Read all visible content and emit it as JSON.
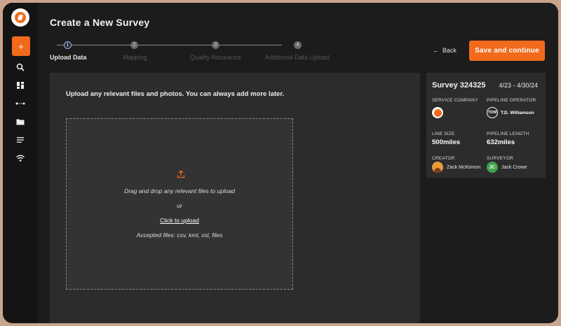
{
  "page": {
    "title": "Create a New Survey"
  },
  "stepper": {
    "steps": [
      {
        "number": "1",
        "label": "Upload Data"
      },
      {
        "number": "2",
        "label": "Mapping"
      },
      {
        "number": "3",
        "label": "Quality Assurance"
      },
      {
        "number": "4",
        "label": "Additional Data Upload"
      }
    ]
  },
  "actions": {
    "back_label": "Back",
    "save_label": "Save and continue"
  },
  "sidebar": {
    "add_label": "+",
    "icons": [
      "search-icon",
      "dashboard-icon",
      "pipeline-icon",
      "folder-icon",
      "list-icon",
      "wifi-icon"
    ]
  },
  "upload": {
    "intro": "Upload any relevant files and photos. You can always add more later.",
    "drag_text": "Drag and drop any relevant files to upload",
    "or_text": "or",
    "click_text": "Click to upload",
    "accepted_text": "Accepted files: csv, kml, xsl, files"
  },
  "survey": {
    "title": "Survey 324325",
    "dates": "4/23 - 4/30/24",
    "service_company_label": "SERVICE COMPANY",
    "pipeline_operator_label": "PIPELINE OPERATOR",
    "pipeline_operator_logo": "TDW",
    "pipeline_operator_name": "T.D. Williamson",
    "line_size_label": "LINE SIZE",
    "line_size_value": "500miles",
    "pipeline_length_label": "PIPELINE LENGTH",
    "pipeline_length_value": "632miles",
    "creator_label": "CREATOR",
    "creator_name": "Zack McKinnon",
    "surveyor_label": "SURVEYOR",
    "surveyor_initials": "JC",
    "surveyor_name": "Jack Crowe"
  },
  "colors": {
    "accent": "#f26b1d",
    "background": "#1c1c1c",
    "panel": "#2c2c2c"
  }
}
